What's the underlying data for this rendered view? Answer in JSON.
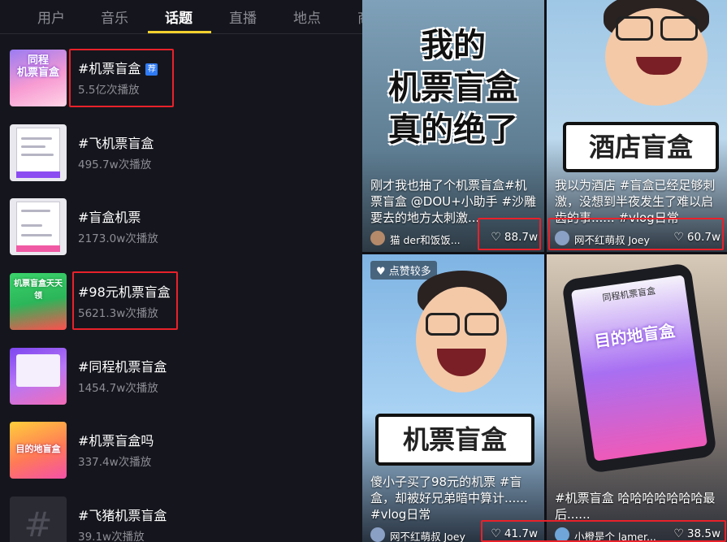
{
  "tabs": [
    {
      "label": "用户"
    },
    {
      "label": "音乐"
    },
    {
      "label": "话题"
    },
    {
      "label": "直播"
    },
    {
      "label": "地点"
    },
    {
      "label": "商"
    }
  ],
  "active_tab": "话题",
  "topics": [
    {
      "name": "#机票盲盒",
      "count": "5.5亿次播放",
      "badge": "荐",
      "thumb_text": "同程\n机票盲盒"
    },
    {
      "name": "#飞机票盲盒",
      "count": "495.7w次播放"
    },
    {
      "name": "#盲盒机票",
      "count": "2173.0w次播放"
    },
    {
      "name": "#98元机票盲盒",
      "count": "5621.3w次播放",
      "thumb_text": "机票盲盒天天领"
    },
    {
      "name": "#同程机票盲盒",
      "count": "1454.7w次播放"
    },
    {
      "name": "#机票盲盒吗",
      "count": "337.4w次播放",
      "thumb_text": "目的地盲盒"
    },
    {
      "name": "#飞猪机票盲盒",
      "count": "39.1w次播放"
    }
  ],
  "videos": [
    {
      "overlay_lines": [
        "我的",
        "机票盲盒",
        "真的绝了"
      ],
      "caption": "刚才我也抽了个机票盲盒#机票盲盒 @DOU+小助手 #沙雕 要去的地方太刺激...",
      "author": "猫 der和饭饭...",
      "likes": "88.7w"
    },
    {
      "overlay_lines": [
        "酒店盲盒"
      ],
      "caption": "我以为酒店 #盲盒已经足够刺激，没想到半夜发生了难以启齿的事...... #vlog日常",
      "author": "网不红萌叔 Joey",
      "likes": "60.7w"
    },
    {
      "hot_badge": "点赞较多",
      "overlay_lines": [
        "机票盲盒"
      ],
      "caption": "傻小子买了98元的机票 #盲盒，却被好兄弟暗中算计...... #vlog日常",
      "author": "网不红萌叔 Joey",
      "likes": "41.7w"
    },
    {
      "phone_title": "同程机票盲盒",
      "phone_heading": "目的地盲盒",
      "caption": "#机票盲盒 哈哈哈哈哈哈哈最后......",
      "author": "小橙是个 lamer...",
      "likes": "38.5w"
    }
  ],
  "colors": {
    "accent_tab": "#f4d12e",
    "highlight": "#e8212a",
    "badge": "#2f7bf6"
  },
  "icons": {
    "heart": "heart-icon",
    "hash": "hash-icon"
  }
}
